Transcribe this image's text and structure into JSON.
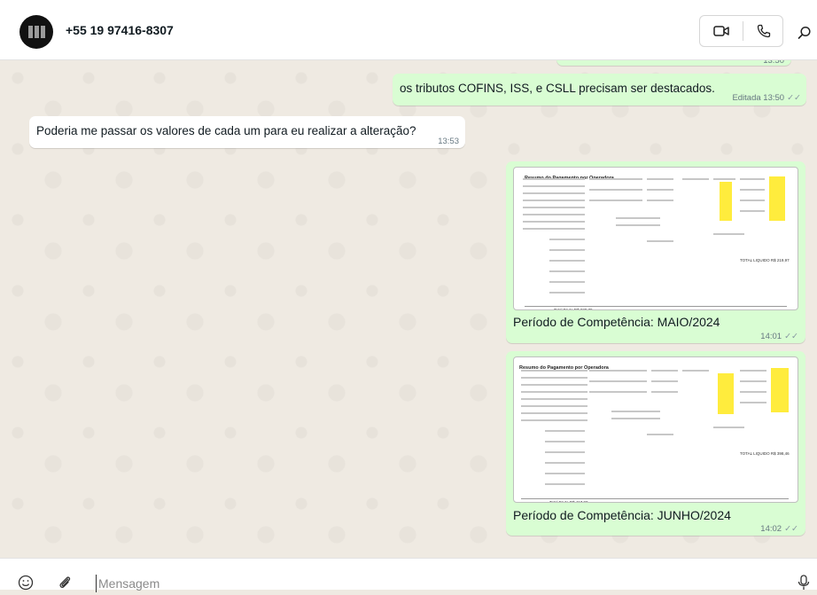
{
  "header": {
    "contact_name": "+55 19 97416-8307",
    "icons": [
      "avatar",
      "video-call-icon",
      "voice-call-icon",
      "search-icon"
    ]
  },
  "messages": [
    {
      "direction": "outgoing",
      "text": "",
      "time": "13:50"
    },
    {
      "direction": "outgoing",
      "text": "os tributos COFINS, ISS, e CSLL precisam ser destacados.",
      "meta": "Editada 13:50"
    },
    {
      "direction": "incoming",
      "text": "Poderia me passar os valores de cada um para eu realizar a alteração?",
      "time": "13:53"
    },
    {
      "direction": "outgoing",
      "type": "image",
      "doc_title": "Resumo do Pagamento por Operadora",
      "doc_total_bruto": "Total Bruto R$ 230,70",
      "doc_total_liquido": "TOTAL LIQUIDO R$ 219,97",
      "caption": "Período de Competência: MAIO/2024",
      "time": "14:01"
    },
    {
      "direction": "outgoing",
      "type": "image",
      "doc_title": "Resumo do Pagamento por Operadora",
      "doc_total_bruto": "Total Bruto R$ 417,90",
      "doc_total_liquido": "TOTAL LIQUIDO R$ 398,46",
      "caption": "Período de Competência: JUNHO/2024",
      "time": "14:02"
    }
  ],
  "composer": {
    "placeholder": "Mensagem",
    "icons": [
      "emoji-icon",
      "attach-icon",
      "mic-icon"
    ]
  },
  "colors": {
    "outgoing_bubble": "#d9fdd3",
    "incoming_bubble": "#ffffff",
    "chat_background": "#efeae2",
    "highlight": "#ffec3d"
  }
}
